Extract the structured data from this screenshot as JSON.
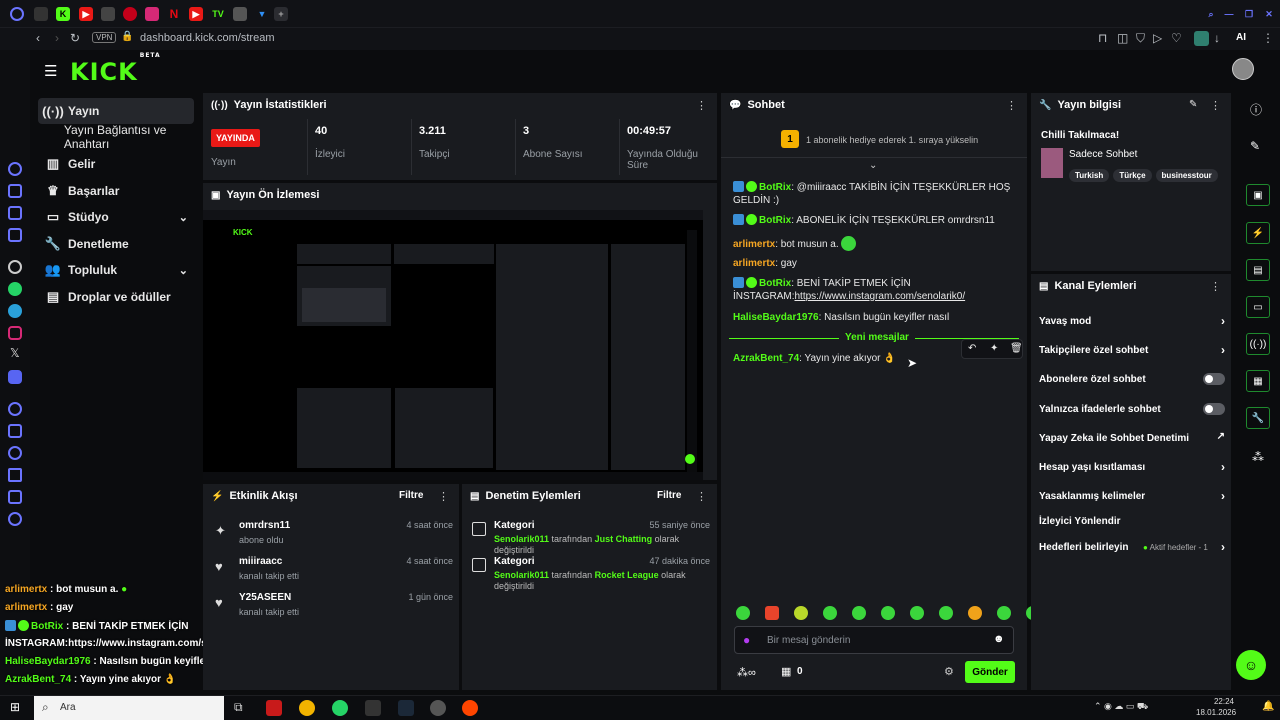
{
  "browser": {
    "url": "dashboard.kick.com/stream",
    "vpn": "VPN",
    "ai_label": "AI"
  },
  "colors": {
    "brand": "#53fc18",
    "live": "#e91916",
    "panel": "#191b1f"
  },
  "nav": {
    "items": [
      {
        "label": "Yayın",
        "icon": "broadcast-icon"
      },
      {
        "label": "Yayın Bağlantısı ve Anahtarı",
        "icon": ""
      },
      {
        "label": "Gelir",
        "icon": "chart-icon"
      },
      {
        "label": "Başarılar",
        "icon": "trophy-icon"
      },
      {
        "label": "Stüdyo",
        "icon": "studio-icon"
      },
      {
        "label": "Denetleme",
        "icon": "wrench-icon"
      },
      {
        "label": "Topluluk",
        "icon": "people-icon"
      },
      {
        "label": "Droplar ve ödüller",
        "icon": "gift-icon"
      }
    ]
  },
  "stats": {
    "title": "Yayın İstatistikleri",
    "live_badge": "YAYINDA",
    "live_label": "Yayın",
    "viewers_value": "40",
    "viewers_label": "İzleyici",
    "followers_value": "3.211",
    "followers_label": "Takipçi",
    "subs_value": "3",
    "subs_label": "Abone Sayısı",
    "uptime_value": "00:49:57",
    "uptime_label": "Yayında Olduğu Süre"
  },
  "preview": {
    "title": "Yayın Ön İzlemesi"
  },
  "activity": {
    "title": "Etkinlik Akışı",
    "filter": "Filtre",
    "items": [
      {
        "name": "omrdrsn11",
        "sub": "abone oldu",
        "time": "4 saat önce"
      },
      {
        "name": "miiiraacc",
        "sub": "kanalı takip etti",
        "time": "4 saat önce"
      },
      {
        "name": "Y25ASEEN",
        "sub": "kanalı takip etti",
        "time": "1 gün önce"
      }
    ]
  },
  "modlog": {
    "title": "Denetim Eylemleri",
    "filter": "Filtre",
    "items": [
      {
        "title": "Kategori",
        "time": "55 saniye önce",
        "user": "Senolarik011",
        "mid": " tarafından ",
        "cat": "Just Chatting",
        "end": " olarak değiştirildi"
      },
      {
        "title": "Kategori",
        "time": "47 dakika önce",
        "user": "Senolarik011",
        "mid": " tarafından ",
        "cat": "Rocket League",
        "end": " olarak değiştirildi"
      }
    ]
  },
  "chat": {
    "title": "Sohbet",
    "pinned": "1 abonelik hediye ederek 1. sıraya yükselin",
    "pinned_rank": "1",
    "messages": [
      {
        "user": "BotRix",
        "text": ": @miiiraacc TAKİBİN İÇİN TEŞEKKÜRLER HOŞ GELDİN :)"
      },
      {
        "user": "BotRix",
        "text": ": ABONELİK İÇİN TEŞEKKÜRLER omrdrsn11"
      },
      {
        "user": "arlimertx",
        "text": ": bot musun a."
      },
      {
        "user": "arlimertx",
        "text": ": gay"
      },
      {
        "user": "BotRix",
        "text": ": BENİ TAKİP ETMEK İÇİN İNSTAGRAM:",
        "link": "https://www.instagram.com/senolarik0/"
      },
      {
        "user": "HaliseBaydar1976",
        "text": ": Nasılsın bugün keyifler nasıl"
      },
      {
        "user": "AzrakBent_74",
        "text": ": Yayın yine akıyor 👌"
      }
    ],
    "new_messages": "Yeni mesajlar",
    "input_placeholder": "Bir mesaj gönderin",
    "count_value": "0",
    "send_label": "Gönder"
  },
  "info": {
    "title": "Yayın bilgisi",
    "stream_title": "Chilli Takılmaca!",
    "category": "Sadece Sohbet",
    "tags": [
      "Turkish",
      "Türkçe",
      "businesstour"
    ]
  },
  "channel_actions": {
    "title": "Kanal Eylemleri",
    "items": [
      {
        "label": "Yavaş mod",
        "type": "arrow"
      },
      {
        "label": "Takipçilere özel sohbet",
        "type": "arrow"
      },
      {
        "label": "Abonelere özel sohbet",
        "type": "toggle"
      },
      {
        "label": "Yalnızca ifadelerle sohbet",
        "type": "toggle"
      },
      {
        "label": "Yapay Zeka ile Sohbet Denetimi",
        "type": "external"
      },
      {
        "label": "Hesap yaşı kısıtlaması",
        "type": "arrow"
      },
      {
        "label": "Yasaklanmış kelimeler",
        "type": "arrow"
      },
      {
        "label": "İzleyici Yönlendir",
        "type": "none"
      },
      {
        "label": "Hedefleri belirleyin",
        "type": "arrow",
        "extra": "Aktif hedefler - 1"
      }
    ]
  },
  "overlay_chat": [
    {
      "user": "arlimertx",
      "text": " : bot musun a."
    },
    {
      "user": "arlimertx",
      "text": " : gay"
    },
    {
      "user": "BotRix",
      "text": " : BENİ TAKİP ETMEK İÇİN"
    },
    {
      "user": "",
      "text": "İNSTAGRAM:https://www.instagram.com/senolarik0/"
    },
    {
      "user": "HaliseBaydar1976",
      "text": " : Nasılsın bugün keyifler nasıl"
    },
    {
      "user": "AzrakBent_74",
      "text": " : Yayın yine akıyor 👌"
    }
  ],
  "taskbar": {
    "search": "Ara",
    "time": "22:24",
    "date": "18.01.2026"
  }
}
